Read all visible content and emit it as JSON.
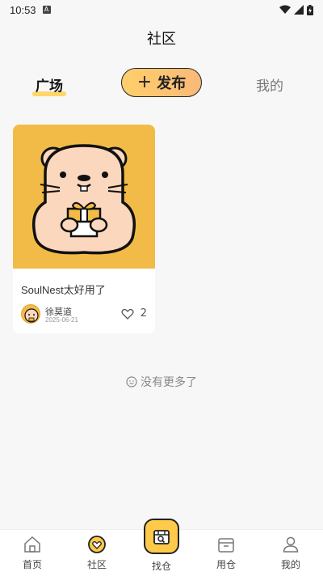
{
  "status_bar": {
    "time": "10:53",
    "badge": "A"
  },
  "header": {
    "title": "社区"
  },
  "tabs": {
    "plaza": "广场",
    "publish": "发布",
    "mine": "我的"
  },
  "posts": [
    {
      "title": "SoulNest太好用了",
      "author": "徐莫道",
      "date": "2025-06-21",
      "likes": "2"
    }
  ],
  "footer": {
    "no_more": "没有更多了"
  },
  "tabbar": {
    "items": [
      {
        "label": "首页",
        "icon": "home-icon"
      },
      {
        "label": "社区",
        "icon": "community-heart-icon"
      },
      {
        "label": "找仓",
        "icon": "find-warehouse-icon"
      },
      {
        "label": "用仓",
        "icon": "box-icon"
      },
      {
        "label": "我的",
        "icon": "user-icon"
      }
    ]
  },
  "colors": {
    "accent": "#ffc94a",
    "card_bg": "#f2bb47",
    "publish_gradient_start": "#ffcf6b",
    "publish_gradient_end": "#f9b979"
  }
}
